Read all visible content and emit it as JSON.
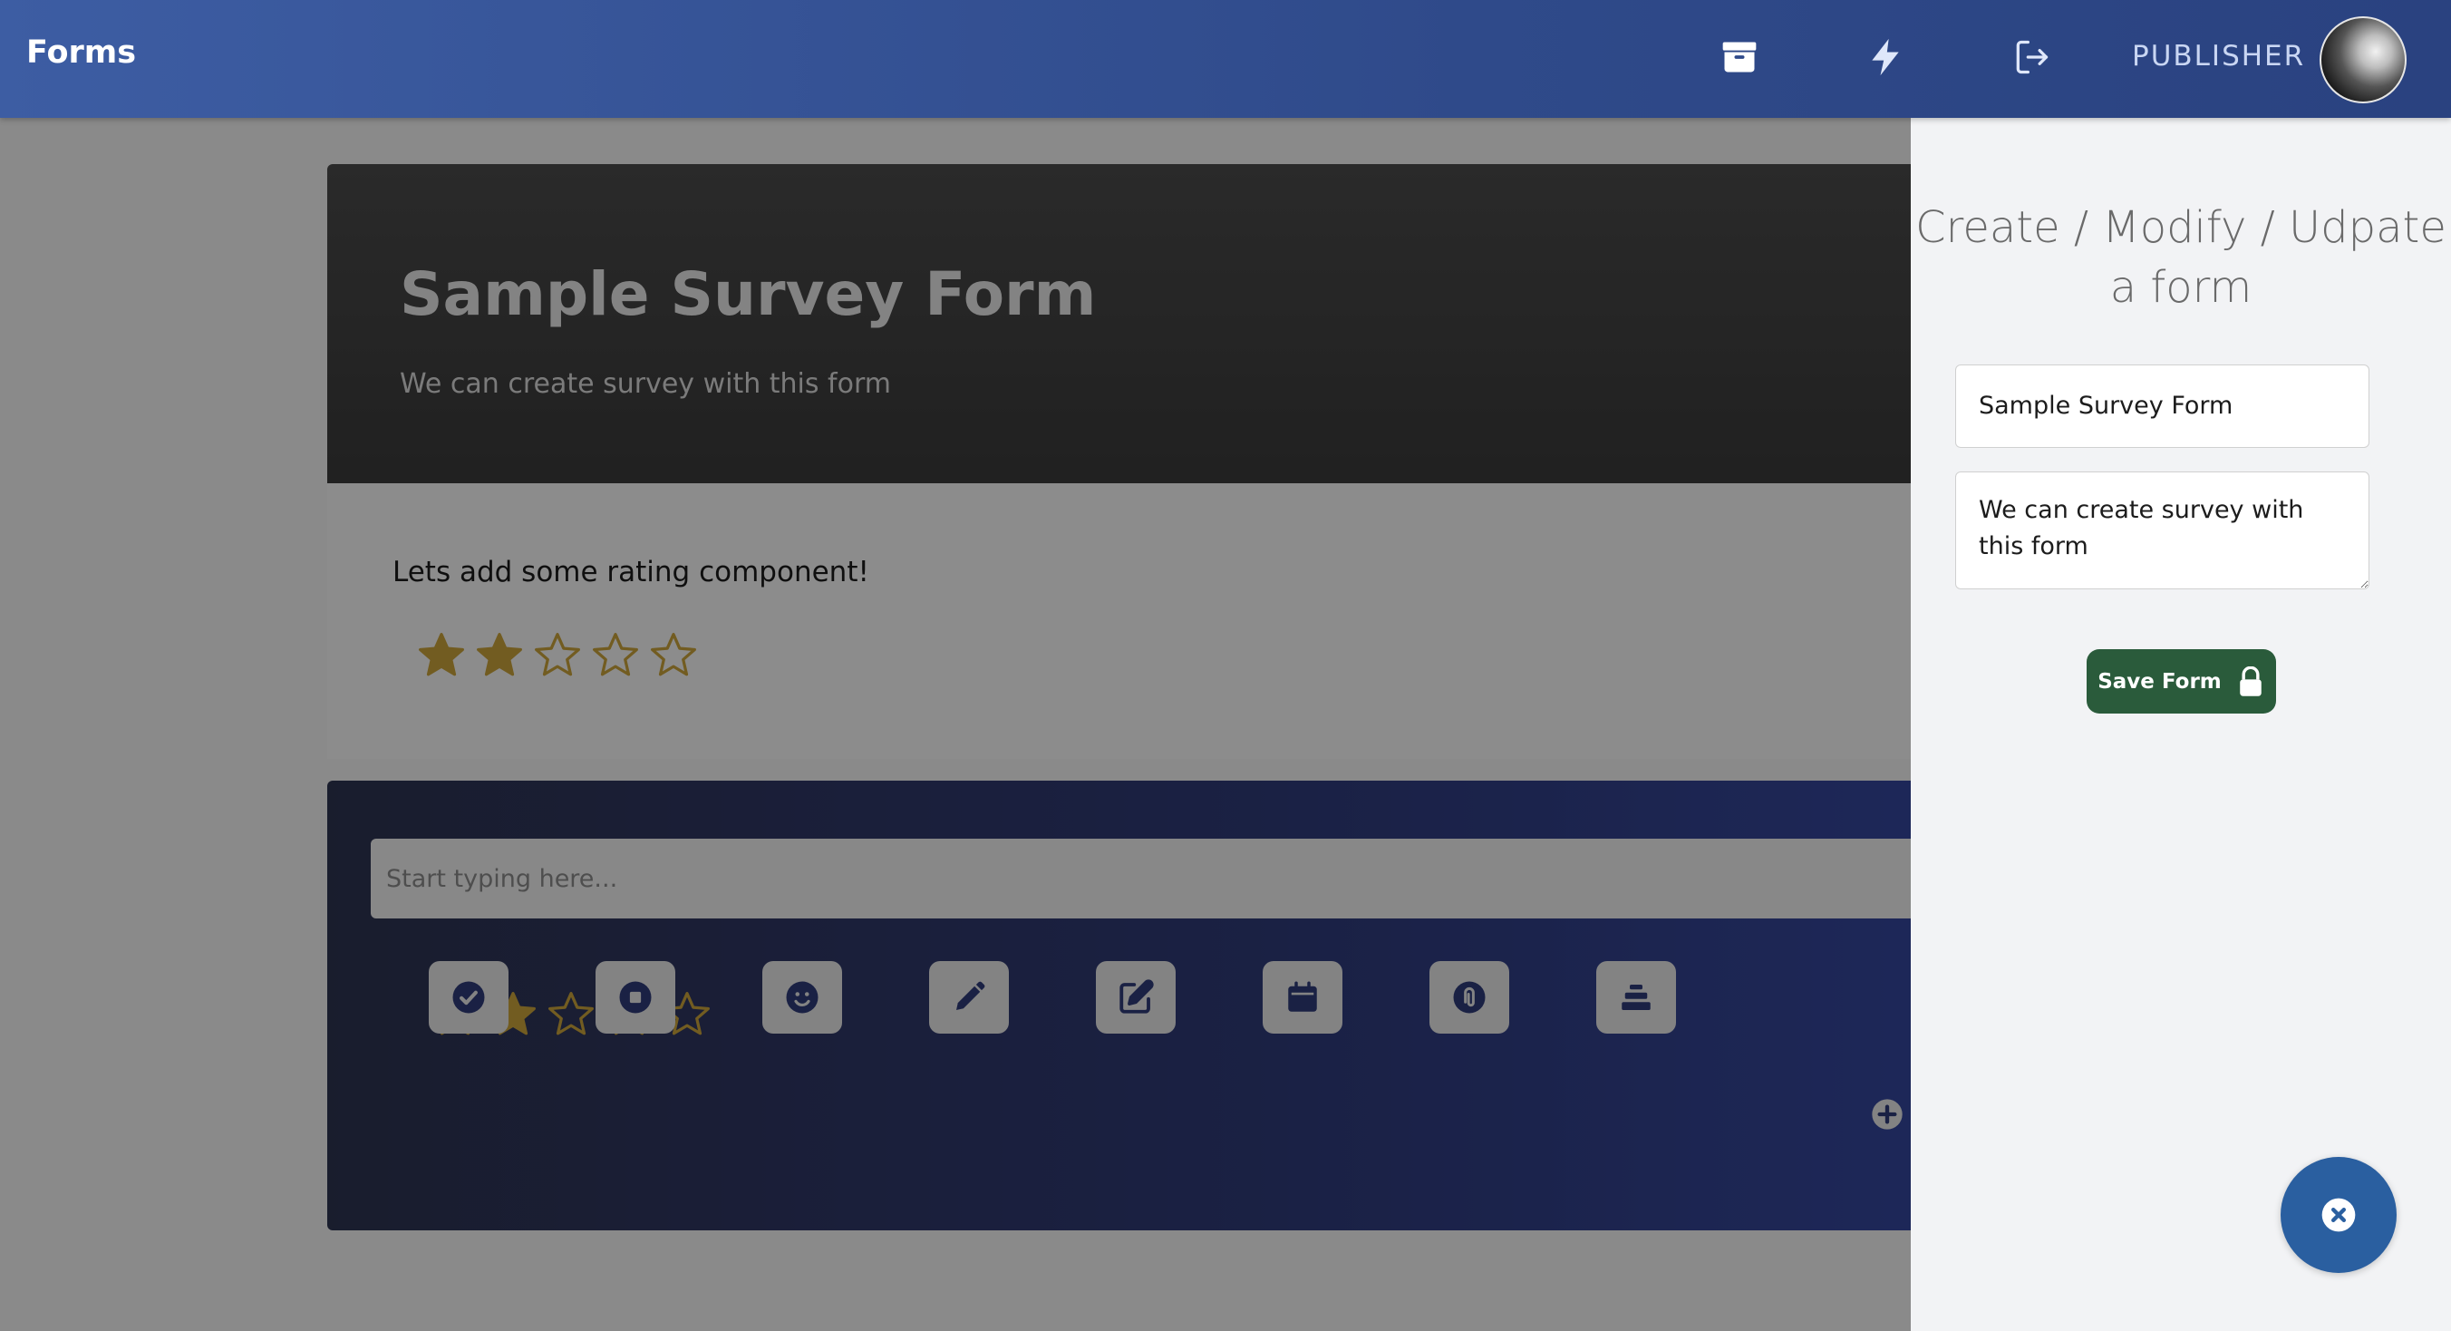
{
  "topbar": {
    "brand": "Forms",
    "icons": [
      "archive-icon",
      "bolt-icon",
      "logout-icon"
    ],
    "user_label": "PUBLISHER"
  },
  "form": {
    "title": "Sample Survey Form",
    "description": "We can create survey with this form"
  },
  "rating_component": {
    "question": "Lets add some rating component!",
    "rating": 2,
    "max": 5
  },
  "editor": {
    "placeholder": "Start typing here...",
    "rating": 2,
    "max": 5,
    "tools": [
      "check-circle-icon",
      "stop-circle-icon",
      "smile-icon",
      "pencil-icon",
      "edit-icon",
      "calendar-icon",
      "paperclip-icon",
      "layers-icon"
    ],
    "add_icon": "plus-circle-icon"
  },
  "panel": {
    "title": "Create / Modify / Udpate a form",
    "title_value": "Sample Survey Form",
    "description_value": "We can create survey with this form",
    "save_label": "Save Form"
  },
  "colors": {
    "topbar": "#3d5da3",
    "star": "#c9a33b",
    "save": "#2a5b3b",
    "fab": "#2a5fa0",
    "editor": "#2f3a78"
  }
}
